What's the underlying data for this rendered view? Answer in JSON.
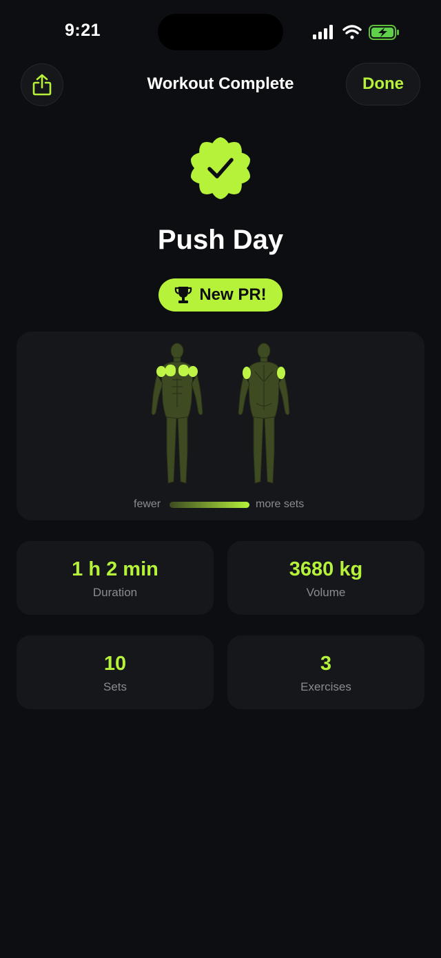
{
  "status_bar": {
    "time": "9:21"
  },
  "nav": {
    "title": "Workout Complete",
    "done_label": "Done"
  },
  "workout": {
    "name": "Push Day",
    "pr_badge": "New PR!"
  },
  "muscle_map": {
    "legend_low": "fewer",
    "legend_high": "more sets"
  },
  "stats": [
    {
      "value": "1 h 2 min",
      "label": "Duration"
    },
    {
      "value": "3680 kg",
      "label": "Volume"
    },
    {
      "value": "10",
      "label": "Sets"
    },
    {
      "value": "3",
      "label": "Exercises"
    }
  ],
  "colors": {
    "accent": "#b6f23a",
    "background": "#0d0e11",
    "card": "#16171b"
  },
  "icons": [
    "share-icon",
    "verified-check-icon",
    "trophy-icon",
    "signal-icon",
    "wifi-icon",
    "battery-charging-icon"
  ]
}
